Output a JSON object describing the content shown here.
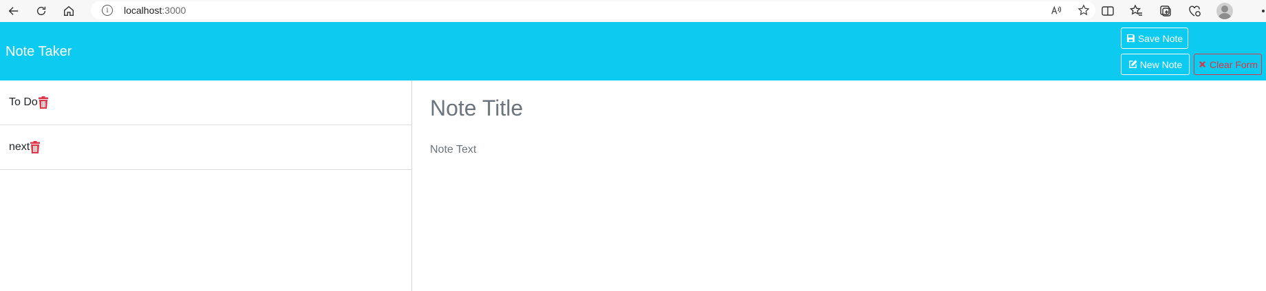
{
  "browser": {
    "url_host": "localhost",
    "url_port": ":3000"
  },
  "navbar": {
    "brand": "Note Taker",
    "save_label": "Save Note",
    "new_label": "New Note",
    "clear_label": "Clear Form"
  },
  "notes": [
    {
      "title": "To Do"
    },
    {
      "title": "next"
    }
  ],
  "editor": {
    "title_placeholder": "Note Title",
    "text_placeholder": "Note Text"
  },
  "colors": {
    "navbar_bg": "#0dcaf0",
    "danger": "#dc3545"
  }
}
